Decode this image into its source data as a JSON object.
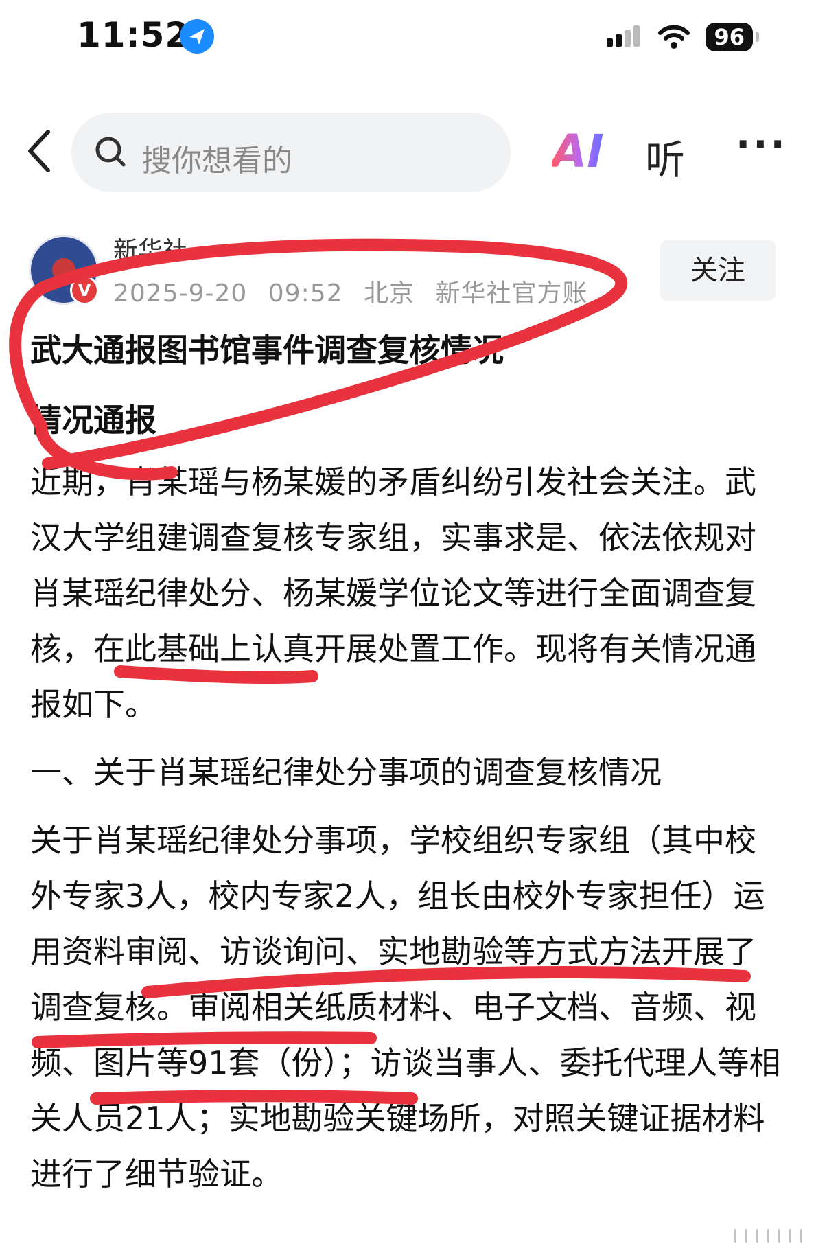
{
  "status_bar": {
    "time": "11:52",
    "battery": "96",
    "icons": [
      "location-arrow-icon",
      "cellular-signal-icon",
      "wifi-icon",
      "battery-icon"
    ]
  },
  "nav": {
    "search_placeholder": "搜你想看的",
    "ai_label": "AI",
    "listen_label": "听",
    "more_label": "···"
  },
  "author": {
    "name": "新华社",
    "date": "2025-9-20",
    "time": "09:52",
    "location": "北京",
    "account": "新华社官方账",
    "verified_label": "V",
    "follow_label": "关注"
  },
  "article": {
    "title": "武大通报图书馆事件调查复核情况",
    "subtitle": "情况通报",
    "intro": "近期，肖某瑶与杨某媛的矛盾纠纷引发社会关注。武汉大学组建调查复核专家组，实事求是、依法依规对肖某瑶纪律处分、杨某媛学位论文等进行全面调查复核，在此基础上认真开展处置工作。现将有关情况通报如下。",
    "section1_heading": "一、关于肖某瑶纪律处分事项的调查复核情况",
    "section1_body": "关于肖某瑶纪律处分事项，学校组织专家组（其中校外专家3人，校内专家2人，组长由校外专家担任）运用资料审阅、访谈询问、实地勘验等方式方法开展了调查复核。审阅相关纸质材料、电子文档、音频、视频、图片等91套（份）；访谈当事人、委托代理人等相关人员21人；实地勘验关键场所，对照关键证据材料进行了细节验证。"
  },
  "annotation": {
    "ink_color": "#e8333f"
  }
}
